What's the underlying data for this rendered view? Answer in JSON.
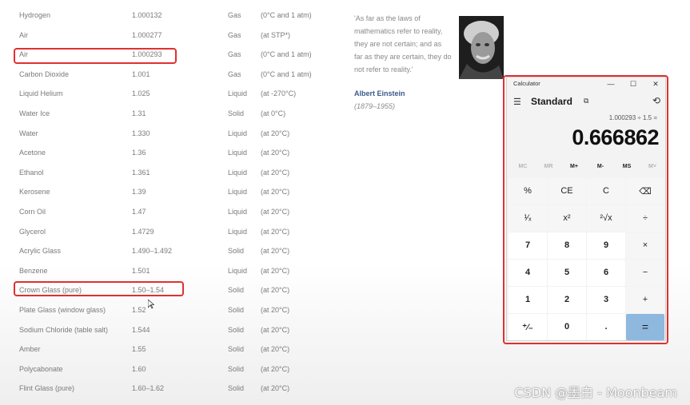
{
  "table": {
    "rows": [
      {
        "name": "Hydrogen",
        "index": "1.000132",
        "state": "Gas",
        "cond": "(0°C and 1 atm)"
      },
      {
        "name": "Air",
        "index": "1.000277",
        "state": "Gas",
        "cond": "(at STP*)"
      },
      {
        "name": "Air",
        "index": "1.000293",
        "state": "Gas",
        "cond": "(0°C and 1 atm)"
      },
      {
        "name": "Carbon Dioxide",
        "index": "1.001",
        "state": "Gas",
        "cond": "(0°C and 1 atm)"
      },
      {
        "name": "Liquid Helium",
        "index": "1.025",
        "state": "Liquid",
        "cond": "(at -270°C)"
      },
      {
        "name": "Water Ice",
        "index": "1.31",
        "state": "Solid",
        "cond": "(at 0°C)"
      },
      {
        "name": "Water",
        "index": "1.330",
        "state": "Liquid",
        "cond": "(at 20°C)"
      },
      {
        "name": "Acetone",
        "index": "1.36",
        "state": "Liquid",
        "cond": "(at 20°C)"
      },
      {
        "name": "Ethanol",
        "index": "1.361",
        "state": "Liquid",
        "cond": "(at 20°C)"
      },
      {
        "name": "Kerosene",
        "index": "1.39",
        "state": "Liquid",
        "cond": "(at 20°C)"
      },
      {
        "name": "Corn Oil",
        "index": "1.47",
        "state": "Liquid",
        "cond": "(at 20°C)"
      },
      {
        "name": "Glycerol",
        "index": "1.4729",
        "state": "Liquid",
        "cond": "(at 20°C)"
      },
      {
        "name": "Acrylic Glass",
        "index": "1.490–1.492",
        "state": "Solid",
        "cond": "(at 20°C)"
      },
      {
        "name": "Benzene",
        "index": "1.501",
        "state": "Liquid",
        "cond": "(at 20°C)"
      },
      {
        "name": "Crown Glass (pure)",
        "index": "1.50–1.54",
        "state": "Solid",
        "cond": "(at 20°C)"
      },
      {
        "name": "Plate Glass (window glass)",
        "index": "1.52",
        "state": "Solid",
        "cond": "(at 20°C)"
      },
      {
        "name": "Sodium Chloride (table salt)",
        "index": "1.544",
        "state": "Solid",
        "cond": "(at 20°C)"
      },
      {
        "name": "Amber",
        "index": "1.55",
        "state": "Solid",
        "cond": "(at 20°C)"
      },
      {
        "name": "Polycabonate",
        "index": "1.60",
        "state": "Solid",
        "cond": "(at 20°C)"
      },
      {
        "name": "Flint Glass (pure)",
        "index": "1.60–1.62",
        "state": "Solid",
        "cond": "(at 20°C)"
      }
    ]
  },
  "quote": {
    "text": "'As far as the laws of mathematics refer to reality, they are not certain; and as far as they are certain, they do not refer to reality.'",
    "author": "Albert Einstein",
    "years": "(1879–1955)"
  },
  "calculator": {
    "title": "Calculator",
    "minimize": "—",
    "maximize": "☐",
    "close": "✕",
    "menu_icon": "☰",
    "mode": "Standard",
    "keep_on_top_icon": "⧉",
    "history_icon": "⟲",
    "expression": "1.000293 ÷ 1.5 =",
    "display": "0.666862",
    "memory": [
      {
        "label": "MC",
        "enabled": false
      },
      {
        "label": "MR",
        "enabled": false
      },
      {
        "label": "M+",
        "enabled": true
      },
      {
        "label": "M-",
        "enabled": true
      },
      {
        "label": "MS",
        "enabled": true
      },
      {
        "label": "M˅",
        "enabled": false
      }
    ],
    "keys": [
      [
        "%",
        "CE",
        "C",
        "⌫"
      ],
      [
        "¹⁄ₓ",
        "x²",
        "²√x",
        "÷"
      ],
      [
        "7",
        "8",
        "9",
        "×"
      ],
      [
        "4",
        "5",
        "6",
        "−"
      ],
      [
        "1",
        "2",
        "3",
        "+"
      ],
      [
        "⁺⁄₋",
        "0",
        ".",
        "="
      ]
    ]
  },
  "watermark": "CSDN @墨白 - Moonbeam",
  "colors": {
    "highlight": "#e03030",
    "equals": "#8fb8de",
    "author": "#3a5a8a"
  }
}
